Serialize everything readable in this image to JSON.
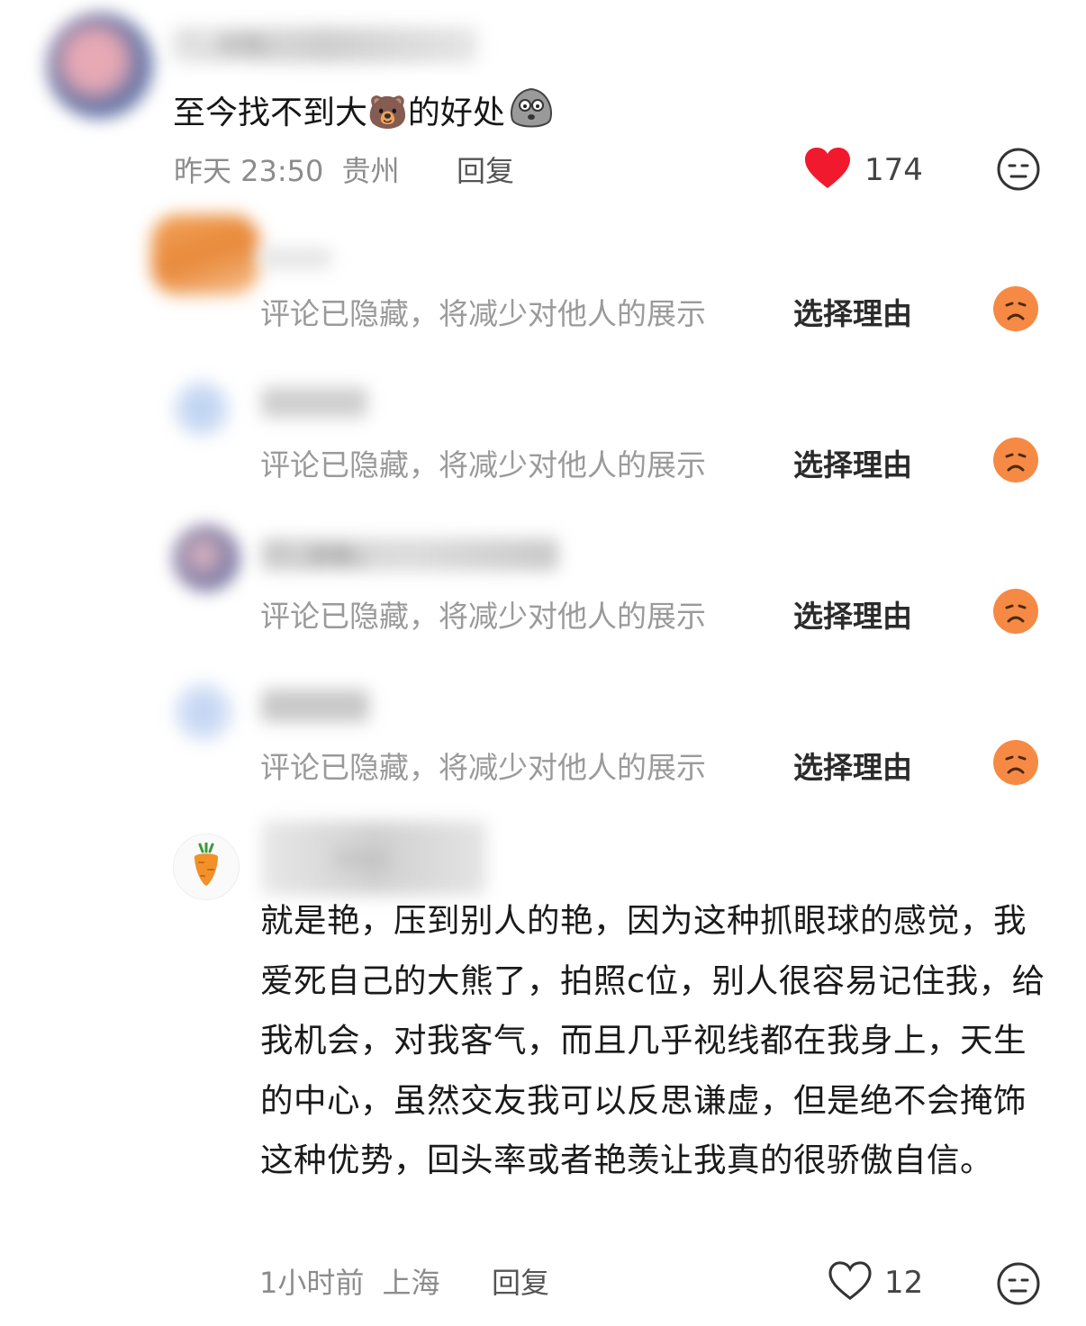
{
  "colors": {
    "heart_red": "#f0192e",
    "dislike_orange": "#f68a44",
    "meta_gray": "#8c8c8c"
  },
  "top_comment": {
    "username": "『…安勒』",
    "text": "至今找不到大🐻的好处",
    "emoji_icon": "stone-face-icon",
    "time": "昨天 23:50",
    "location": "贵州",
    "reply_label": "回复",
    "likes": "174",
    "liked": true,
    "dislike_icon": "neutral-face-icon"
  },
  "hidden_replies": [
    {
      "username": "",
      "notice": "评论已隐藏，将减少对他人的展示",
      "action": "选择理由",
      "icon": "sad-face-icon"
    },
    {
      "username": "",
      "notice": "评论已隐藏，将减少对他人的展示",
      "action": "选择理由",
      "icon": "sad-face-icon"
    },
    {
      "username": "『…安勒』",
      "notice": "评论已隐藏，将减少对他人的展示",
      "action": "选择理由",
      "icon": "sad-face-icon"
    },
    {
      "username": "",
      "notice": "评论已隐藏，将减少对他人的展示",
      "action": "选择理由",
      "icon": "sad-face-icon"
    }
  ],
  "last_reply": {
    "username": "mei",
    "avatar_icon": "carrot-icon",
    "text": "就是艳，压到别人的艳，因为这种抓眼球的感觉，我爱死自己的大熊了，拍照c位，别人很容易记住我，给我机会，对我客气，而且几乎视线都在我身上，天生的中心，虽然交友我可以反思谦虚，但是绝不会掩饰这种优势，回头率或者艳羡让我真的很骄傲自信。",
    "time": "1小时前",
    "location": "上海",
    "reply_label": "回复",
    "likes": "12",
    "liked": false,
    "dislike_icon": "neutral-face-icon"
  }
}
